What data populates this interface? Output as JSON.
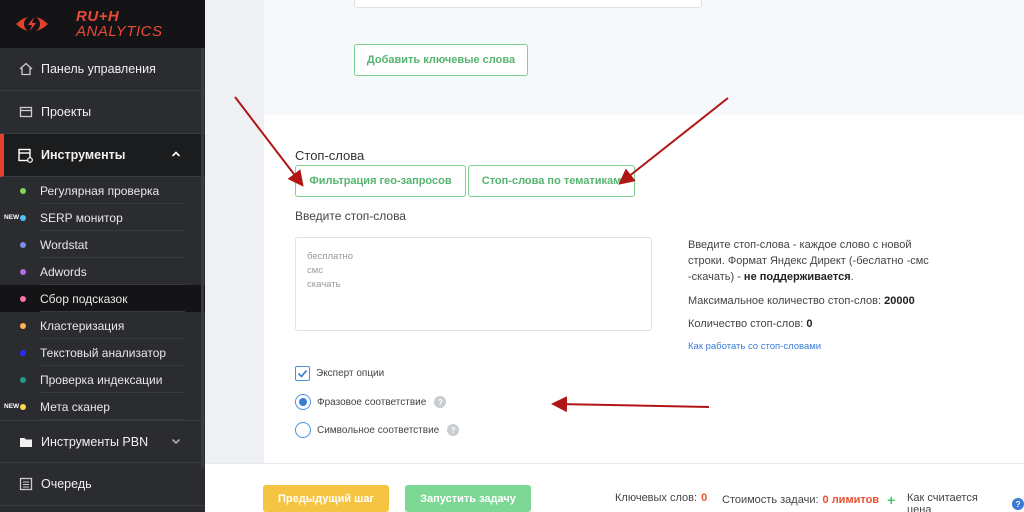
{
  "logo": {
    "line1": "RU+H",
    "line2": "ANALYTICS"
  },
  "sidebar": {
    "items": [
      {
        "label": "Панель управления",
        "icon": "home-icon"
      },
      {
        "label": "Проекты",
        "icon": "folder-icon"
      },
      {
        "label": "Инструменты",
        "icon": "tools-icon"
      }
    ],
    "tools": [
      {
        "label": "Регулярная проверка",
        "color": "#7ed957",
        "new": ""
      },
      {
        "label": "SERP монитор",
        "color": "#4fc3f7",
        "new": "NEW"
      },
      {
        "label": "Wordstat",
        "color": "#7b8ce6",
        "new": ""
      },
      {
        "label": "Adwords",
        "color": "#b36ee6",
        "new": ""
      },
      {
        "label": "Сбор подсказок",
        "color": "#ff6fa8",
        "new": ""
      },
      {
        "label": "Кластеризация",
        "color": "#ffb45c",
        "new": ""
      },
      {
        "label": "Текстовый анализатор",
        "color": "#2a2aff",
        "new": ""
      },
      {
        "label": "Проверка индексации",
        "color": "#1e9e82",
        "new": ""
      },
      {
        "label": "Мета сканер",
        "color": "#ffd84d",
        "new": "NEW"
      }
    ],
    "pbn": {
      "label": "Инструменты PBN",
      "icon": "folder-icon"
    },
    "queue": {
      "label": "Очередь",
      "icon": "list-icon"
    }
  },
  "main": {
    "add_keywords": "Добавить ключевые слова",
    "stop_words_title": "Стоп-слова",
    "geo_filter": "Фильтрация гео-запросов",
    "topic_stop_words": "Стоп-слова по тематикам",
    "enter_label": "Введите стоп-слова",
    "textarea_placeholder": "бесплатно\nсмс\nскачать",
    "info_1": "Введите стоп-слова - каждое слово с новой строки. Формат Яндекс Директ (-беслатно -смс -скачать) - ",
    "info_1_bold": "не поддерживается",
    "info_1_end": ".",
    "max_label": "Максимальное количество стоп-слов: ",
    "max_value": "20000",
    "count_label": "Количество стоп-слов: ",
    "count_value": "0",
    "howto_link": "Как работать со стоп-словами",
    "expert_options": "Эксперт опции",
    "phrase_match": "Фразовое соответствие",
    "symbol_match": "Символьное соответствие"
  },
  "footer": {
    "prev": "Предыдущий шаг",
    "run": "Запустить задачу",
    "keywords_label": "Ключевых слов:",
    "keywords_value": "0",
    "cost_label": "Стоимость задачи:",
    "cost_value": "0 лимитов",
    "plus": "+",
    "how_price": "Как считается цена"
  },
  "colors": {
    "accent_red": "#e8402f",
    "green": "#55b56f",
    "yellow": "#f6c443",
    "run_green": "#7dd896",
    "arrow": "#b01515"
  }
}
